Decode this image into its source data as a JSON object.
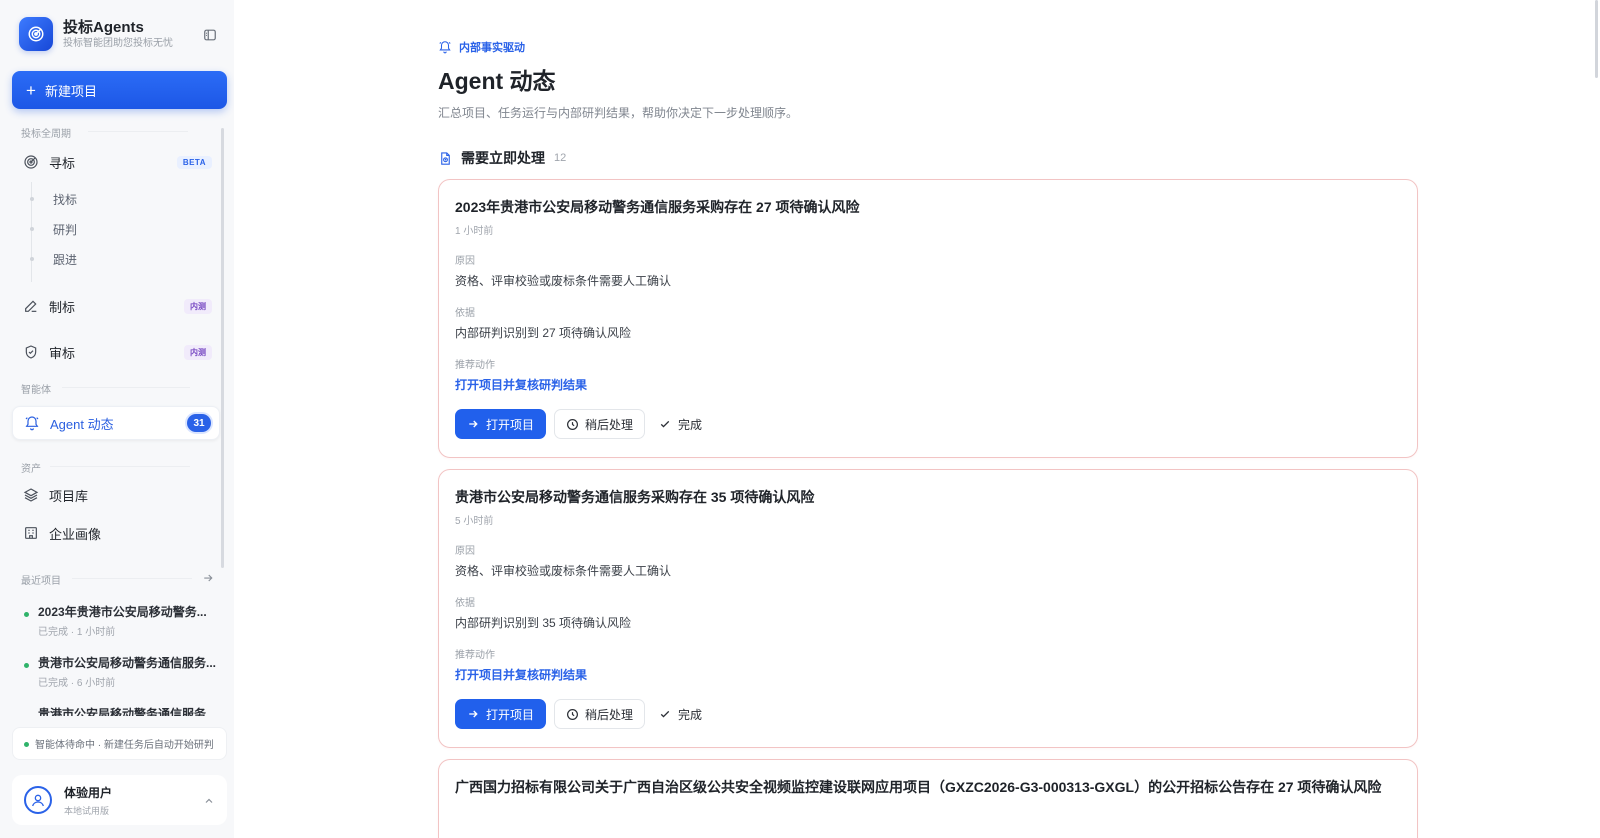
{
  "brand": {
    "title": "投标Agents",
    "subtitle": "投标智能团助您投标无忧"
  },
  "new_project": {
    "label": "新建项目"
  },
  "sections": {
    "lifecycle": "投标全周期",
    "agents": "智能体",
    "assets": "资产",
    "recent": "最近项目"
  },
  "nav": {
    "xunbiao": {
      "label": "寻标",
      "tag": "BETA"
    },
    "xunbiao_sub": [
      "找标",
      "研判",
      "跟进"
    ],
    "zhibiao": {
      "label": "制标",
      "tag": "内测"
    },
    "shenbiao": {
      "label": "审标",
      "tag": "内测"
    },
    "agent_dynamics": {
      "label": "Agent 动态",
      "count": "31"
    },
    "project_lib": {
      "label": "项目库"
    },
    "enterprise": {
      "label": "企业画像"
    }
  },
  "recent_projects": [
    {
      "title": "2023年贵港市公安局移动警务...",
      "meta": "已完成 · 1 小时前"
    },
    {
      "title": "贵港市公安局移动警务通信服务...",
      "meta": "已完成 · 6 小时前"
    },
    {
      "title": "贵港市公安局移动警务通信服务..."
    }
  ],
  "status": {
    "text": "智能体待命中 · 新建任务后自动开始研判"
  },
  "user": {
    "name": "体验用户",
    "subtitle": "本地试用版"
  },
  "page": {
    "eyebrow": "内部事实驱动",
    "title": "Agent 动态",
    "description": "汇总项目、任务运行与内部研判结果，帮助你决定下一步处理顺序。",
    "section_title": "需要立即处理",
    "section_count": "12"
  },
  "labels": {
    "reason": "原因",
    "basis": "依据",
    "recommend": "推荐动作",
    "open": "打开项目",
    "later": "稍后处理",
    "done": "完成"
  },
  "cards": [
    {
      "title": "2023年贵港市公安局移动警务通信服务采购存在 27 项待确认风险",
      "time": "1 小时前",
      "reason": "资格、评审校验或废标条件需要人工确认",
      "basis": "内部研判识别到 27 项待确认风险",
      "action": "打开项目并复核研判结果"
    },
    {
      "title": "贵港市公安局移动警务通信服务采购存在 35 项待确认风险",
      "time": "5 小时前",
      "reason": "资格、评审校验或废标条件需要人工确认",
      "basis": "内部研判识别到 35 项待确认风险",
      "action": "打开项目并复核研判结果"
    },
    {
      "title": "广西国力招标有限公司关于广西自治区级公共安全视频监控建设联网应用项目（GXZC2026-G3-000313-GXGL）的公开招标公告存在 27 项待确认风险"
    }
  ],
  "colors": {
    "accent": "#2160ec",
    "card_border": "#f2c4c4",
    "status_green": "#2fb36a"
  }
}
